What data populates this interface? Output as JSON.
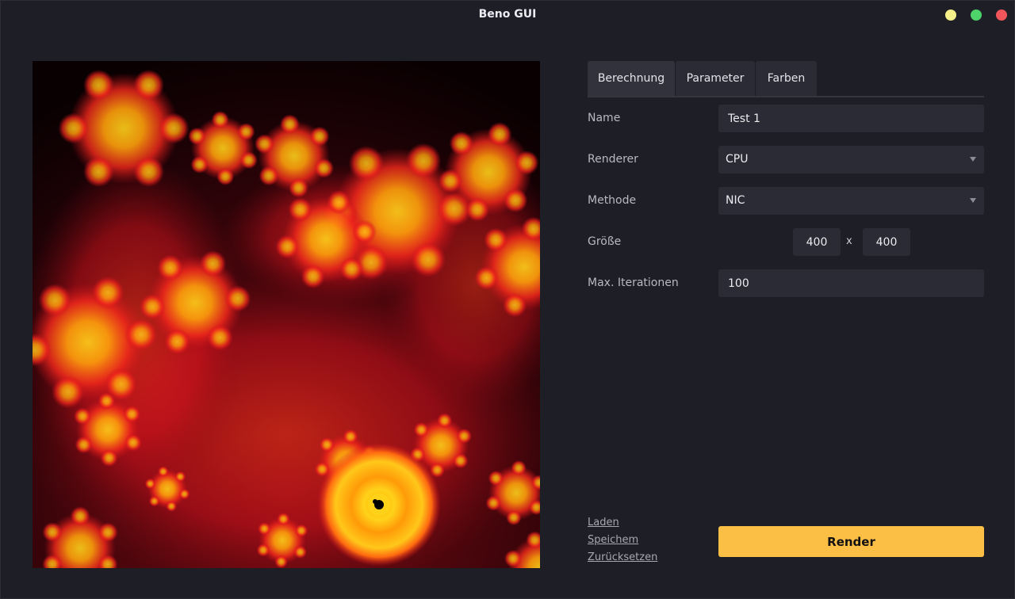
{
  "window": {
    "title": "Beno GUI",
    "controls": {
      "minimize_color": "#f5f08a",
      "maximize_color": "#4ed36a",
      "close_color": "#f0555a"
    }
  },
  "tabs": [
    "Berechnung",
    "Parameter",
    "Farben"
  ],
  "form": {
    "name_label": "Name",
    "name_value": "Test 1",
    "renderer_label": "Renderer",
    "renderer_value": "CPU",
    "method_label": "Methode",
    "method_value": "NIC",
    "size_label": "Größe",
    "size_width": "400",
    "size_separator": "x",
    "size_height": "400",
    "iterations_label": "Max. Iterationen",
    "iterations_value": "100"
  },
  "links": {
    "load": "Laden",
    "save": "Speichem",
    "reset": "Zurücksetzen"
  },
  "render_button": "Render",
  "colors": {
    "accent": "#fbbf45",
    "background": "#1d1e26",
    "input_bg": "#2a2b34"
  }
}
